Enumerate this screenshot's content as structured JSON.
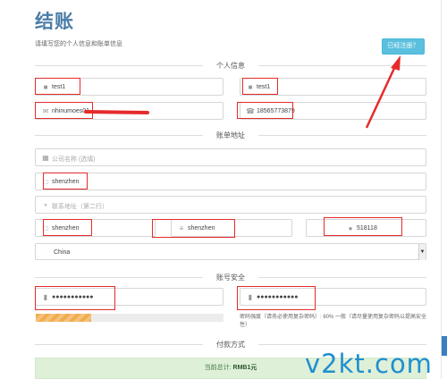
{
  "header": {
    "title": "结账",
    "subtitle": "请填写您的个人信息和账单信息",
    "login_button": "已经注册？"
  },
  "sections": {
    "personal": "个人信息",
    "billing": "账单地址",
    "security": "账号安全",
    "payment": "付款方式"
  },
  "personal": {
    "first_name": "test1",
    "last_name": "test1",
    "email": "nhinumoes01",
    "phone": "18565773879"
  },
  "billing": {
    "company_placeholder": "公司名称 (选填)",
    "address1": "shenzhen",
    "address2_placeholder": "联系地址（第二行）",
    "city": "shenzhen",
    "state": "shenzhen",
    "postcode": "518118",
    "country": "China"
  },
  "security": {
    "password": "●●●●●●●●●●●",
    "password_confirm": "●●●●●●●●●●●",
    "strength_label": "密码强度（请务必使用复杂密码）: 60% 一般（请尽量使用复杂密码以提高安全性）",
    "strength_percent": 60
  },
  "payment": {
    "total_label": "当前总计:",
    "total_value": "RMB1元"
  },
  "watermark": "v2kt.com",
  "colors": {
    "title": "#4a7da8",
    "login_button": "#5bc0de",
    "annotation": "#e52b2b",
    "progress": "#f0ad4e",
    "total_bar": "#dff0d8"
  }
}
